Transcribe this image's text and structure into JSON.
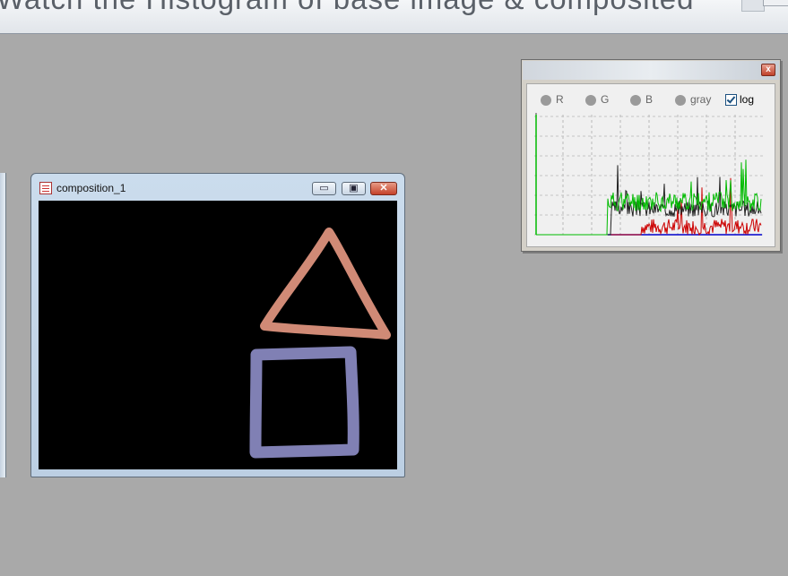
{
  "background_window": {
    "title": "Watch the Histogram of base image & composited"
  },
  "image_window": {
    "title": "composition_1",
    "minimize_label": "▭",
    "maximize_label": "▣",
    "close_label": "✕",
    "canvas": {
      "triangle_color": "#d08a76",
      "square_color": "#8080b4",
      "background_color": "#000000"
    }
  },
  "histogram_window": {
    "close_label": "x",
    "channels": [
      {
        "label": "R",
        "selected": false
      },
      {
        "label": "G",
        "selected": false
      },
      {
        "label": "B",
        "selected": false
      },
      {
        "label": "gray",
        "selected": false
      }
    ],
    "log": {
      "label": "log",
      "checked": true
    },
    "series_colors": {
      "R": "#cc0000",
      "G": "#00bb00",
      "B": "#0000cc",
      "gray": "#222222"
    }
  }
}
